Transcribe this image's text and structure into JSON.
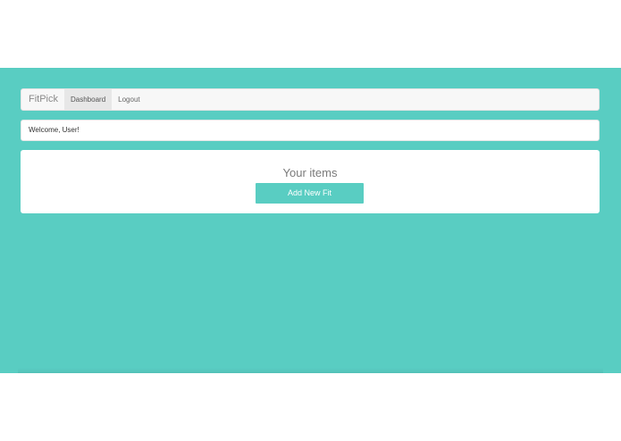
{
  "navbar": {
    "brand": "FitPick",
    "items": [
      {
        "label": "Dashboard",
        "active": true
      },
      {
        "label": "Logout",
        "active": false
      }
    ]
  },
  "welcome": {
    "text": "Welcome, User!"
  },
  "items_panel": {
    "title": "Your items",
    "add_button_label": "Add New Fit"
  },
  "colors": {
    "accent": "#59cdc2",
    "page_background": "#ffffff",
    "navbar_background": "#f7f7f7",
    "active_nav_background": "#e7e7e7"
  }
}
